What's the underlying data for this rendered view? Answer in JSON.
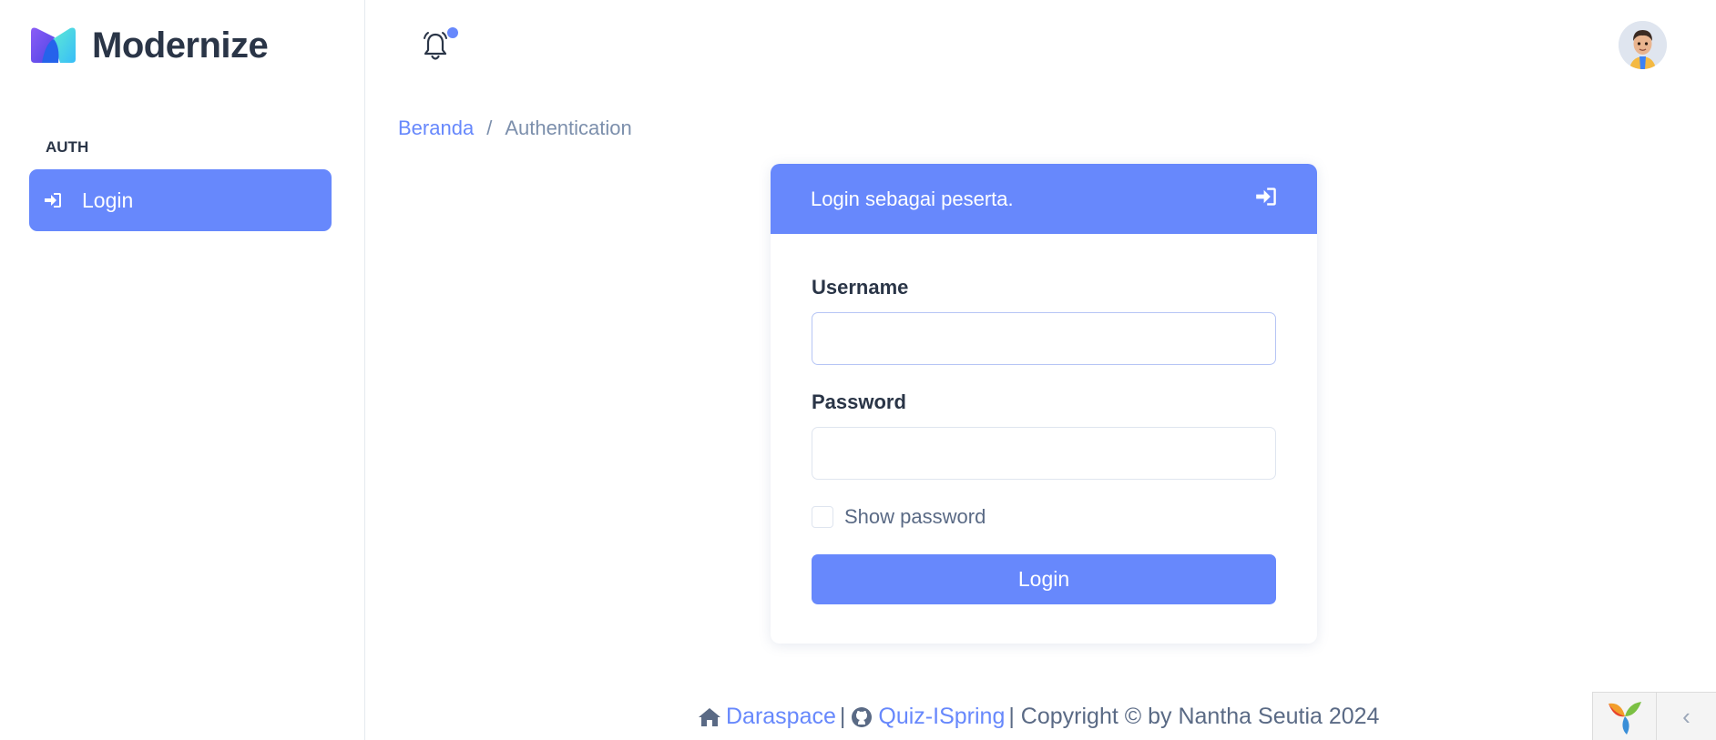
{
  "brand": {
    "name": "Modernize"
  },
  "sidebar": {
    "caption": "AUTH",
    "items": [
      {
        "label": "Login",
        "icon": "sign-in-icon",
        "active": true
      }
    ]
  },
  "topbar": {
    "notification_icon": "bell-icon",
    "avatar_icon": "user-avatar"
  },
  "breadcrumb": {
    "home": "Beranda",
    "separator": "/",
    "current": "Authentication"
  },
  "card": {
    "title": "Login sebagai peserta.",
    "header_icon": "sign-in-icon",
    "username_label": "Username",
    "username_value": "",
    "password_label": "Password",
    "password_value": "",
    "show_password_label": "Show password",
    "show_password_checked": false,
    "submit_label": "Login"
  },
  "footer": {
    "link1": "Daraspace",
    "sep1": "|",
    "link2": "Quiz-ISpring",
    "copyright": "| Copyright © by Nantha Seutia 2024"
  },
  "colors": {
    "primary": "#6788fc",
    "text": "#2a3547",
    "muted": "#7c8fac"
  },
  "debug_toolbar": {
    "logo_icon": "yii-logo-icon",
    "toggle_icon": "chevron-left-icon"
  }
}
